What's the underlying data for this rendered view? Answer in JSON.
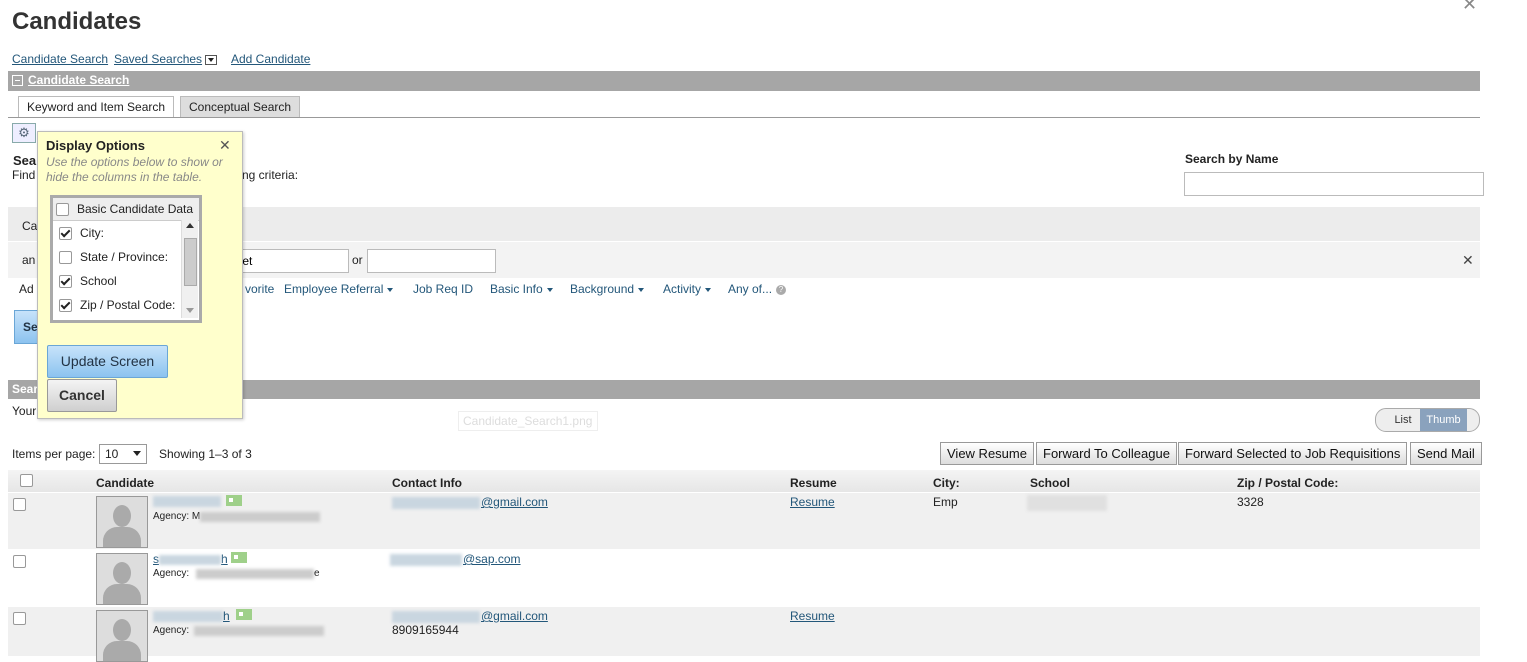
{
  "page": {
    "title": "Candidates"
  },
  "toplinks": {
    "search": "Candidate Search",
    "saved": "Saved Searches",
    "add": "Add Candidate"
  },
  "section": {
    "title": "Candidate Search"
  },
  "tabs": [
    {
      "label": "Keyword and Item Search"
    },
    {
      "label": "Conceptual Search"
    }
  ],
  "search": {
    "heading_fragment": "Sea",
    "find_fragment": "Find",
    "criteria_fragment": "ng criteria:",
    "by_name_label": "Search by Name",
    "by_name_value": "",
    "ca_fragment": "Ca",
    "an_fragment": "an",
    "term_value": "jeet",
    "or_label": "or",
    "term2_value": "",
    "add_fragment": "Ad",
    "button_fragment": "Se"
  },
  "filters": [
    {
      "label": "vorite",
      "caret": false
    },
    {
      "label": "Employee Referral",
      "caret": true
    },
    {
      "label": "Job Req ID",
      "caret": false
    },
    {
      "label": "Basic Info",
      "caret": true
    },
    {
      "label": "Background",
      "caret": true
    },
    {
      "label": "Activity",
      "caret": true
    },
    {
      "label": "Any of...",
      "caret": false
    }
  ],
  "results": {
    "band_fragment": "Sear",
    "your_fragment": "Your",
    "ghost_text": "Candidate_Search1.png",
    "view_list": "List",
    "view_thumb": "Thumb",
    "items_per_page_label": "Items per page:",
    "items_per_page": "10",
    "showing": "Showing 1–3 of 3"
  },
  "actions": [
    "View Resume",
    "Forward To Colleague",
    "Forward Selected to Job Requisitions",
    "Send Mail"
  ],
  "columns": [
    "Candidate",
    "Contact Info",
    "Resume",
    "City:",
    "School",
    "Zip / Postal Code:"
  ],
  "rows": [
    {
      "agency_label": "Agency:",
      "agency_initial": "M",
      "name_end": "",
      "email_suffix": "@gmail.com",
      "resume": "Resume",
      "city": "Emp",
      "zip": "3328",
      "phone": ""
    },
    {
      "agency_label": "Agency:",
      "agency_initial": "",
      "name_start": "s",
      "name_end": "h",
      "agency_end": "e",
      "email_suffix": "@sap.com",
      "resume": "",
      "city": "",
      "zip": "",
      "phone": ""
    },
    {
      "agency_label": "Agency:",
      "agency_initial": "",
      "name_end": "h",
      "email_suffix": "@gmail.com",
      "resume": "Resume",
      "city": "",
      "zip": "",
      "phone": "8909165944"
    }
  ],
  "display_options": {
    "title": "Display Options",
    "desc": "Use the options below to show or hide the columns in the table.",
    "group": "Basic Candidate Data",
    "options": [
      {
        "label": "City:",
        "checked": true
      },
      {
        "label": "State / Province:",
        "checked": false
      },
      {
        "label": "School",
        "checked": true
      },
      {
        "label": "Zip / Postal Code:",
        "checked": true
      }
    ],
    "update": "Update Screen",
    "cancel": "Cancel"
  },
  "icons": {
    "gear": "gear-icon",
    "close": "close-icon",
    "help": "help-icon",
    "card": "contact-card-icon"
  }
}
